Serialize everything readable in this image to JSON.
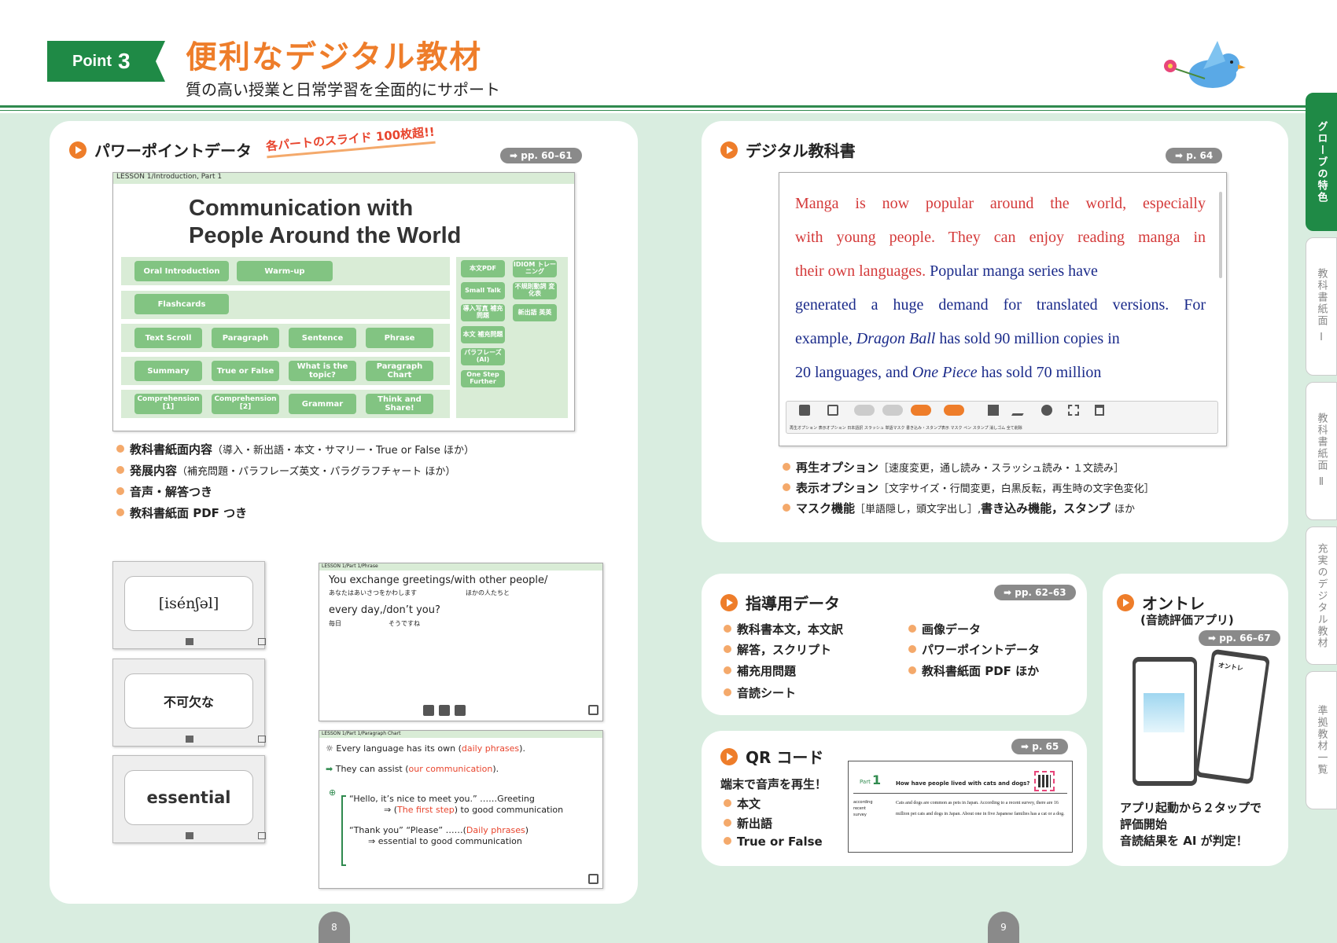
{
  "header": {
    "badge_text": "Point",
    "badge_num": "3",
    "title": "便利なデジタル教材",
    "subtitle": "質の高い授業と日常学習を全面的にサポート"
  },
  "ppt": {
    "heading": "パワーポイントデータ",
    "callout": "各パートのスライド 100枚超!!",
    "page_ref": "➡ pp. 60–61",
    "slide_header": "LESSON 1/Introduction, Part 1",
    "slide_title1": "Communication with",
    "slide_title2": "People Around the World",
    "buttons": [
      "Oral Introduction",
      "Warm-up",
      "Flashcards",
      "Text Scroll",
      "Paragraph",
      "Sentence",
      "Phrase",
      "Summary",
      "True or False",
      "What is the topic?",
      "Paragraph Chart",
      "Comprehension [1]",
      "Comprehension [2]",
      "Grammar",
      "Think and Share!"
    ],
    "side_buttons": [
      "本文PDF",
      "IDIOM トレーニング",
      "Small Talk",
      "不規則動詞 変化表",
      "導入写真 補充問題",
      "新出語 英英",
      "本文 補充問題",
      "パラフレーズ (AI)",
      "One Step Further"
    ],
    "bullets": [
      {
        "bold": "教科書紙面内容",
        "rest": "（導入・新出語・本文・サマリー・True or False ほか）"
      },
      {
        "bold": "発展内容",
        "rest": "（補充問題・パラフレーズ英文・パラグラフチャート ほか）"
      },
      {
        "bold": "音声・解答つき",
        "rest": ""
      },
      {
        "bold": "教科書紙面 PDF つき",
        "rest": ""
      }
    ]
  },
  "flashcards": [
    "[isénʃəl]",
    "不可欠な",
    "essential"
  ],
  "phrase_slide": {
    "header": "LESSON 1/Part 1/Phrase",
    "line1": "You exchange greetings/with other people/",
    "jp1a": "あなたはあいさつをかわします",
    "jp1b": "ほかの人たちと",
    "line2": "every day,/don’t you?",
    "jp2a": "毎日",
    "jp2b": "そうですね"
  },
  "chart_slide": {
    "header": "LESSON 1/Part 1/Paragraph Chart",
    "l1a": "Every language has its own (",
    "l1b": "daily phrases",
    "l1c": ").",
    "l2a": "They can assist (",
    "l2b": "our communication",
    "l2c": ").",
    "l3": "“Hello, it’s nice to meet you.” ……Greeting",
    "l4a": "⇒ (",
    "l4b": "The first step",
    "l4c": ") to good communication",
    "l5a": "“Thank you” “Please” ……(",
    "l5b": "Daily phrases",
    "l5c": ")",
    "l6": "⇒ essential to good communication"
  },
  "textbook": {
    "heading": "デジタル教科書",
    "page_ref": "➡ p. 64",
    "lines": [
      "Manga is now popular around the world, especially",
      "with young people. They can enjoy reading manga in",
      "their own languages.",
      "Popular manga series have",
      "generated a huge demand for translated versions. For",
      "example,",
      "Dragon Ball",
      "has sold 90 million copies in",
      "20 languages, and",
      "One Piece",
      "has sold 70 million"
    ],
    "toolbar": [
      "再生オプション",
      "表示オプション",
      "日本語訳",
      "スラッシュ",
      "単語マスク",
      "書き込み・スタンプ表示",
      "マスク",
      "ペン",
      "スタンプ",
      "消しゴム",
      "全て削除"
    ],
    "bullets": [
      {
        "bold": "再生オプション",
        "rest": "［速度変更，通し読み・スラッシュ読み・１文読み］"
      },
      {
        "bold": "表示オプション",
        "rest": "［文字サイズ・行間変更，白黒反転，再生時の文字色変化］"
      },
      {
        "bold": "マスク機能",
        "rest": "［単語隠し，頭文字出し］,",
        "bold2": "書き込み機能，スタンプ",
        "rest2": "ほか"
      }
    ]
  },
  "shidou": {
    "heading": "指導用データ",
    "page_ref": "➡ pp. 62–63",
    "items_left": [
      "教科書本文，本文訳",
      "解答，スクリプト",
      "補充用問題",
      "音読シート"
    ],
    "items_right": [
      "画像データ",
      "パワーポイントデータ",
      "教科書紙面 PDF ほか"
    ]
  },
  "ontore": {
    "heading": "オントレ",
    "sub": "(音読評価アプリ)",
    "page_ref": "➡ pp. 66–67",
    "phone_title": "オントレ",
    "desc": [
      "アプリ起動から２タップで",
      "評価開始",
      "音読結果を AI が判定！"
    ]
  },
  "qr": {
    "heading": "QR コード",
    "page_ref": "➡ p. 65",
    "lead": "端末で音声を再生！",
    "items": [
      "本文",
      "新出語",
      "True or False"
    ],
    "part": "Part",
    "part_num": "1",
    "q": "How have people lived with cats and dogs?",
    "vocab": [
      "according",
      "recent",
      "survey"
    ],
    "text": "Cats and dogs are common as pets in Japan. According to a recent survey, there are 16 million pet cats and dogs in Japan. About one in five Japanese families has a cat or a dog."
  },
  "side_tabs": [
    "グローブの特色",
    "教科書紙面 Ⅰ",
    "教科書紙面 Ⅱ",
    "充実のデジタル教材",
    "準拠教材一覧"
  ],
  "page_numbers": [
    "8",
    "9"
  ],
  "colors": {
    "accent": "#ee7d2a",
    "green": "#1f8a46",
    "bg": "#d9ede0"
  }
}
